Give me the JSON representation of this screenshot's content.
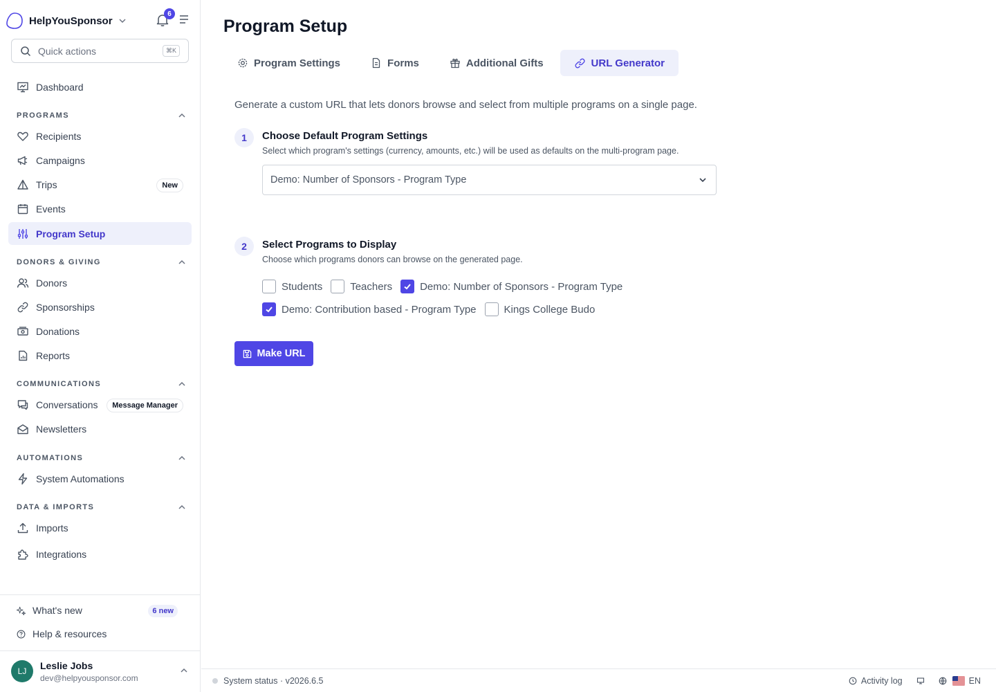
{
  "brand": {
    "name": "HelpYouSponsor",
    "notifications_count": "6"
  },
  "search": {
    "placeholder": "Quick actions",
    "shortcut": "⌘K"
  },
  "sidebar": {
    "dashboard": "Dashboard",
    "sections": {
      "programs": "PROGRAMS",
      "donors": "DONORS & GIVING",
      "communications": "COMMUNICATIONS",
      "automations": "AUTOMATIONS",
      "data": "DATA & IMPORTS"
    },
    "items": {
      "recipients": "Recipients",
      "campaigns": "Campaigns",
      "trips": "Trips",
      "trips_badge": "New",
      "events": "Events",
      "program_setup": "Program Setup",
      "donors": "Donors",
      "sponsorships": "Sponsorships",
      "donations": "Donations",
      "reports": "Reports",
      "conversations": "Conversations",
      "conversations_badge": "Message Manager",
      "newsletters": "Newsletters",
      "system_automations": "System Automations",
      "imports": "Imports",
      "integrations": "Integrations"
    },
    "footer": {
      "whats_new": "What's new",
      "whats_new_badge": "6 new",
      "help": "Help & resources"
    },
    "user": {
      "initials": "LJ",
      "name": "Leslie Jobs",
      "email": "dev@helpyousponsor.com"
    }
  },
  "page": {
    "title": "Program Setup",
    "tabs": [
      {
        "label": "Program Settings",
        "icon": "gear-icon"
      },
      {
        "label": "Forms",
        "icon": "document-icon"
      },
      {
        "label": "Additional Gifts",
        "icon": "gift-icon"
      },
      {
        "label": "URL Generator",
        "icon": "link-icon",
        "active": true
      }
    ],
    "intro": "Generate a custom URL that lets donors browse and select from multiple programs on a single page.",
    "step1": {
      "number": "1",
      "title": "Choose Default Program Settings",
      "desc": "Select which program's settings (currency, amounts, etc.) will be used as defaults on the multi-program page.",
      "selected": "Demo: Number of Sponsors - Program Type"
    },
    "step2": {
      "number": "2",
      "title": "Select Programs to Display",
      "desc": "Choose which programs donors can browse on the generated page.",
      "programs": [
        {
          "label": "Students",
          "checked": false
        },
        {
          "label": "Teachers",
          "checked": false
        },
        {
          "label": "Demo: Number of Sponsors - Program Type",
          "checked": true
        },
        {
          "label": "Demo: Contribution based - Program Type",
          "checked": true
        },
        {
          "label": "Kings College Budo",
          "checked": false
        }
      ]
    },
    "make_url": "Make URL"
  },
  "statusbar": {
    "status": "System status · v2026.6.5",
    "activity_log": "Activity log",
    "language": "EN"
  },
  "colors": {
    "accent": "#4f46e5",
    "accent_bg": "#eef0fb",
    "avatar": "#1f7a6a"
  }
}
